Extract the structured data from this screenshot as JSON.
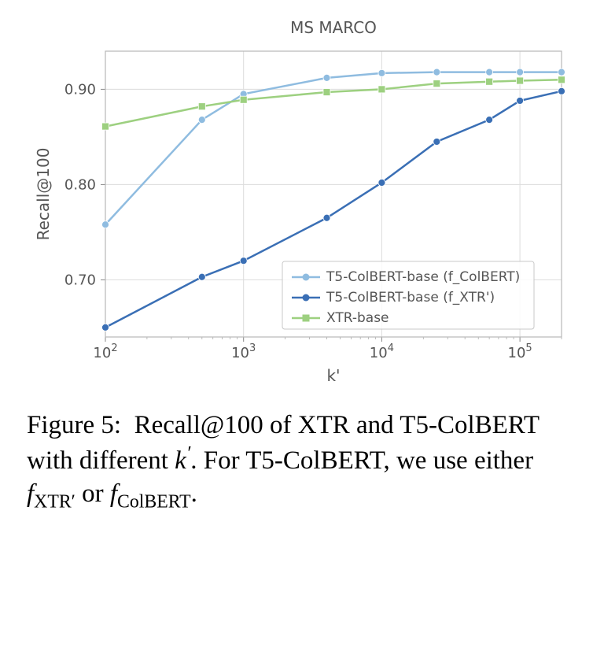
{
  "chart_data": {
    "type": "line",
    "title": "MS MARCO",
    "xlabel": "k'",
    "ylabel": "Recall@100",
    "xscale": "log",
    "x": [
      100,
      500,
      1000,
      4000,
      10000,
      25000,
      60000,
      100000,
      200000
    ],
    "x_ticks": [
      100,
      1000,
      10000,
      100000
    ],
    "x_tick_labels": [
      "10²",
      "10³",
      "10⁴",
      "10⁵"
    ],
    "y_ticks": [
      0.7,
      0.8,
      0.9
    ],
    "ylim": [
      0.64,
      0.94
    ],
    "series": [
      {
        "name": "T5-ColBERT-base (f_ColBERT)",
        "color": "#8fbce0",
        "marker": "circle",
        "values": [
          0.758,
          0.868,
          0.895,
          0.912,
          0.917,
          0.918,
          0.918,
          0.918,
          0.918
        ]
      },
      {
        "name": "T5-ColBERT-base (f_XTR')",
        "color": "#3a6fb5",
        "marker": "circle",
        "values": [
          0.65,
          0.703,
          0.72,
          0.765,
          0.802,
          0.845,
          0.868,
          0.888,
          0.898
        ]
      },
      {
        "name": "XTR-base",
        "color": "#9dd080",
        "marker": "square",
        "values": [
          0.861,
          0.882,
          0.889,
          0.897,
          0.9,
          0.906,
          0.908,
          0.909,
          0.91
        ]
      }
    ]
  },
  "caption": {
    "figure_num": "Figure 5:",
    "text_parts": {
      "a": "Recall@100 of XTR and T5-ColBERT with different ",
      "b": ". For T5-ColBERT, we use ei­ther ",
      "c": " or ",
      "d": "."
    },
    "symbols": {
      "k_prime": "k",
      "k_sup": "′",
      "f": "f",
      "xtr": "XTR′",
      "colbert": "ColBERT"
    }
  }
}
